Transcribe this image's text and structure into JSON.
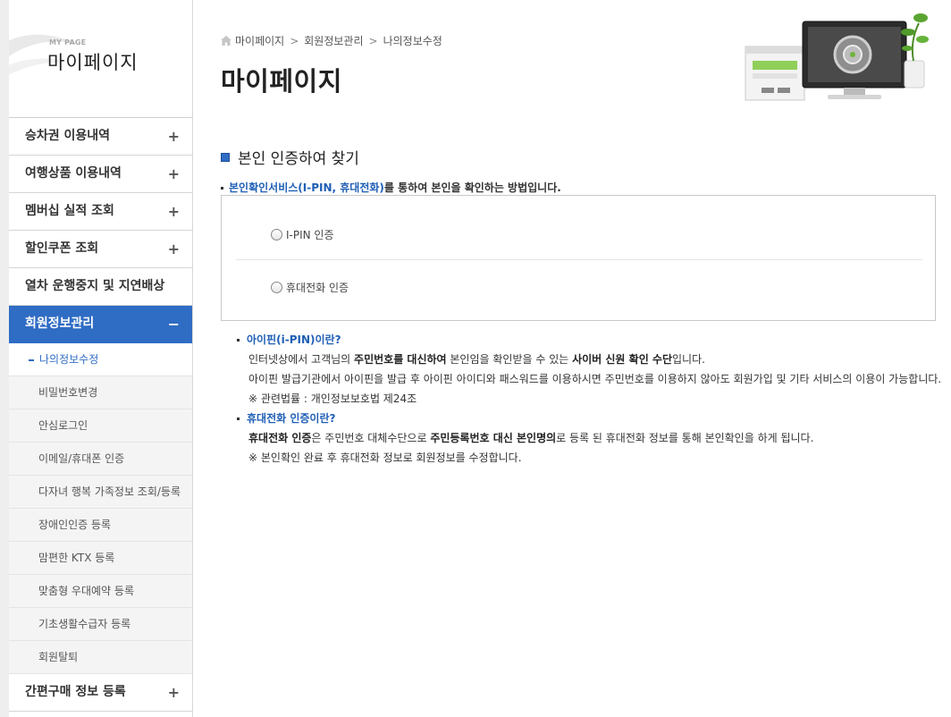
{
  "sidebar": {
    "header_sub": "MY PAGE",
    "header_title": "마이페이지",
    "menu": [
      {
        "label": "승차권 이용내역",
        "toggle": "+"
      },
      {
        "label": "여행상품 이용내역",
        "toggle": "+"
      },
      {
        "label": "멤버십 실적 조회",
        "toggle": "+"
      },
      {
        "label": "할인쿠폰 조회",
        "toggle": "+"
      },
      {
        "label": "열차 운행중지 및 지연배상",
        "toggle": ""
      },
      {
        "label": "회원정보관리",
        "toggle": "−"
      }
    ],
    "submenu": [
      "나의정보수정",
      "비밀번호변경",
      "안심로그인",
      "이메일/휴대폰 인증",
      "다자녀 행복 가족정보 조회/등록",
      "장애인인증 등록",
      "맘편한 KTX 등록",
      "맞춤형 우대예약 등록",
      "기초생활수급자 등록",
      "회원탈퇴"
    ],
    "bottom_menu": {
      "label": "간편구매 정보 등록",
      "toggle": "+"
    }
  },
  "breadcrumb": {
    "items": [
      "마이페이지",
      "회원정보관리",
      "나의정보수정"
    ],
    "separator": ">"
  },
  "page_title": "마이페이지",
  "section": {
    "title": "본인 인증하여 찾기",
    "lead_highlight": "본인확인서비스(I-PIN, 휴대전화)",
    "lead_rest": "를 통하여 본인을 확인하는 방법입니다."
  },
  "auth_options": [
    {
      "label": "I-PIN 인증",
      "selected": false
    },
    {
      "label": "휴대전화 인증",
      "selected": false
    }
  ],
  "info": {
    "ipin_question": "아이핀(i-PIN)이란?",
    "ipin_l1_a": "인터넷상에서 고객님의 ",
    "ipin_l1_b": "주민번호를 대신하여",
    "ipin_l1_c": " 본인임을 확인받을 수 있는 ",
    "ipin_l1_d": "사이버 신원 확인 수단",
    "ipin_l1_e": "입니다.",
    "ipin_l2": "아이핀 발급기관에서 아이핀을 발급 후 아이핀 아이디와 패스워드를 이용하시면 주민번호를 이용하지 않아도 회원가입 및 기타 서비스의 이용이 가능합니다.",
    "ipin_l3": "※ 관련법률 : 개인정보보호법 제24조",
    "phone_question": "휴대전화 인증이란?",
    "phone_l1_a": "휴대전화 인증",
    "phone_l1_b": "은 주민번호 대체수단으로 ",
    "phone_l1_c": "주민등록번호 대신 본인명의",
    "phone_l1_d": "로 등록 된 휴대전화 정보를 통해 본인확인을 하게 됩니다.",
    "phone_l2": "※ 본인확인 완료 후 휴대전화 정보로 회원정보를 수정합니다."
  },
  "colors": {
    "accent": "#2f6cc4",
    "link": "#1f5fb5"
  }
}
